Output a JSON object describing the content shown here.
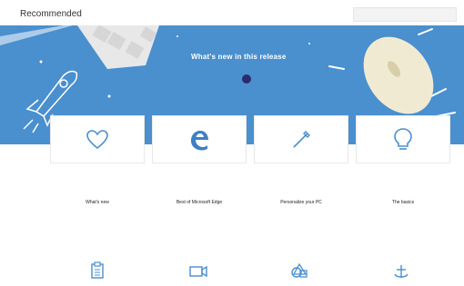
{
  "header": {
    "section_title": "Recommended"
  },
  "hero": {
    "text": "What's new in this release",
    "background": "#4a8fce",
    "accent": "#2c2c6a"
  },
  "tiles": [
    {
      "label": "What's new",
      "icon": "heart-icon"
    },
    {
      "label": "Best of Microsoft Edge",
      "icon": "edge-logo-icon"
    },
    {
      "label": "Personalize your PC",
      "icon": "brush-icon"
    },
    {
      "label": "The basics",
      "icon": "lightbulb-icon"
    }
  ],
  "bottom_row_icons": [
    "clipboard-icon",
    "video-camera-icon",
    "shapes-icon",
    "anchor-icon"
  ]
}
